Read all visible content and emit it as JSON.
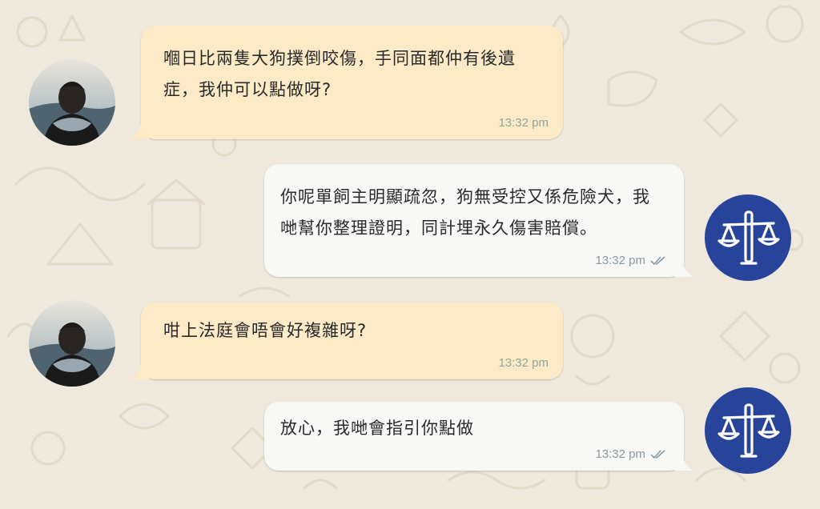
{
  "chat": {
    "messages": [
      {
        "direction": "in",
        "text": "嗰日比兩隻大狗撲倒咬傷，手同面都仲有後遺症，我仲可以點做呀?",
        "time": "13:32 pm"
      },
      {
        "direction": "out",
        "text": "你呢單飼主明顯疏忽，狗無受控又係危險犬，我哋幫你整理證明，同計埋永久傷害賠償。",
        "time": "13:32 pm",
        "status": "read-double-check-icon"
      },
      {
        "direction": "in",
        "text": "咁上法庭會唔會好複雜呀?",
        "time": "13:32 pm"
      },
      {
        "direction": "out",
        "text": "放心，我哋會指引你點做",
        "time": "13:32 pm",
        "status": "read-double-check-icon"
      }
    ]
  },
  "colors": {
    "incoming_bubble": "#fdebc8",
    "outgoing_bubble": "#f8f8f6",
    "lawyer_avatar": "#27439a",
    "background": "#efe9dd"
  },
  "icons": {
    "user_avatar": "person-back-view-photo",
    "lawyer_avatar": "scales-of-justice-icon",
    "read_receipt": "double-check-icon"
  }
}
